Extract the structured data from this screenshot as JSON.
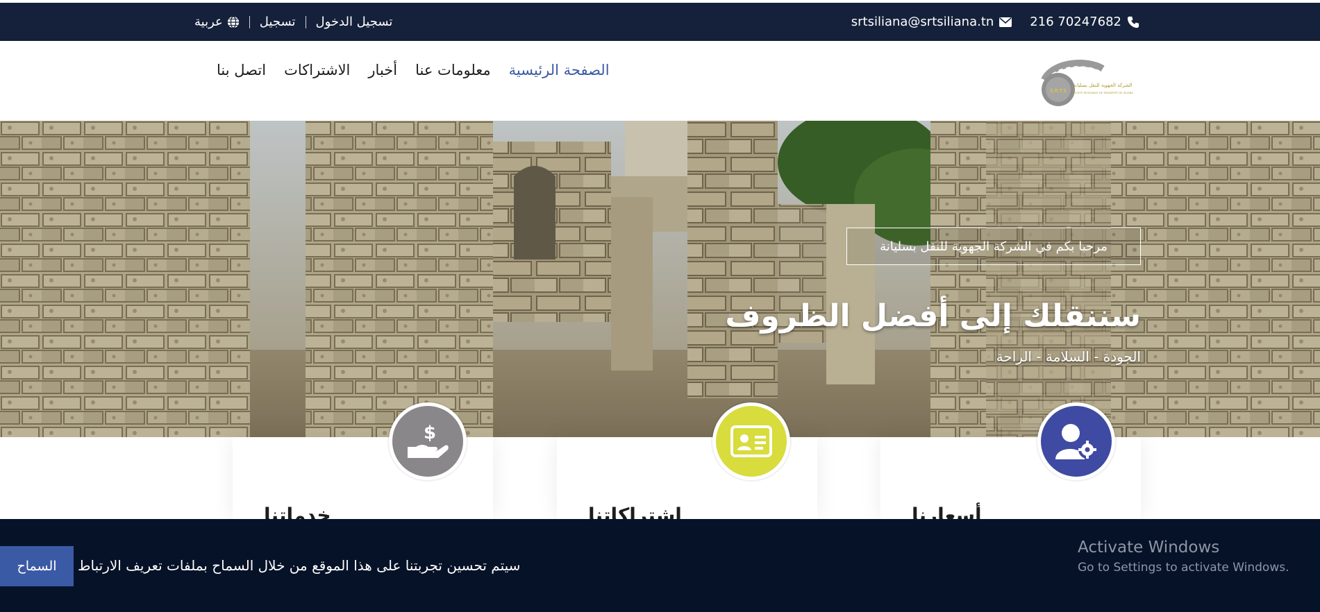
{
  "topbar": {
    "language": "عربية",
    "register": "تسجيل",
    "login": "تسجيل الدخول",
    "email": "srtsiliana@srtsiliana.tn",
    "phone": "216 70247682"
  },
  "nav": {
    "items": [
      {
        "label": "اتصل بنا"
      },
      {
        "label": "الاشتراكات"
      },
      {
        "label": "أخبار"
      },
      {
        "label": "معلومات عنا"
      },
      {
        "label": "الصفحة الرئيسية",
        "active": true
      }
    ]
  },
  "logo": {
    "badge": "S.R.T.S",
    "name_ar": "الشركة الجهوية للنقل بسليانة",
    "name_fr": "SOCIETE REGIONALE DE TRANSPORT DE SILIANA"
  },
  "hero": {
    "welcome": "مرحبا بكم في الشركة الجهوية للنقل بسليانة",
    "title": "سننقلك إلى أفضل الظروف",
    "subtitle": "الجودة - السلامة - الراحة"
  },
  "cards": [
    {
      "title": "خدماتنا",
      "icon": "hand-dollar-icon",
      "color": "#8a878b"
    },
    {
      "title": "اشتراكاتنا",
      "icon": "id-card-icon",
      "color": "#d8dc3c"
    },
    {
      "title": "أسعارنا",
      "icon": "user-gear-icon",
      "color": "#3f4aa2"
    }
  ],
  "cookie": {
    "text": "سيتم تحسين تجربتنا على هذا الموقع من خلال السماح بملفات تعريف الارتباط",
    "button": "السماح"
  },
  "windows": {
    "line1": "Activate Windows",
    "line2": "Go to Settings to activate Windows."
  },
  "colors": {
    "topbar_bg": "#15213a",
    "accent": "#3b5aa6",
    "cookie_bg": "#061228"
  }
}
